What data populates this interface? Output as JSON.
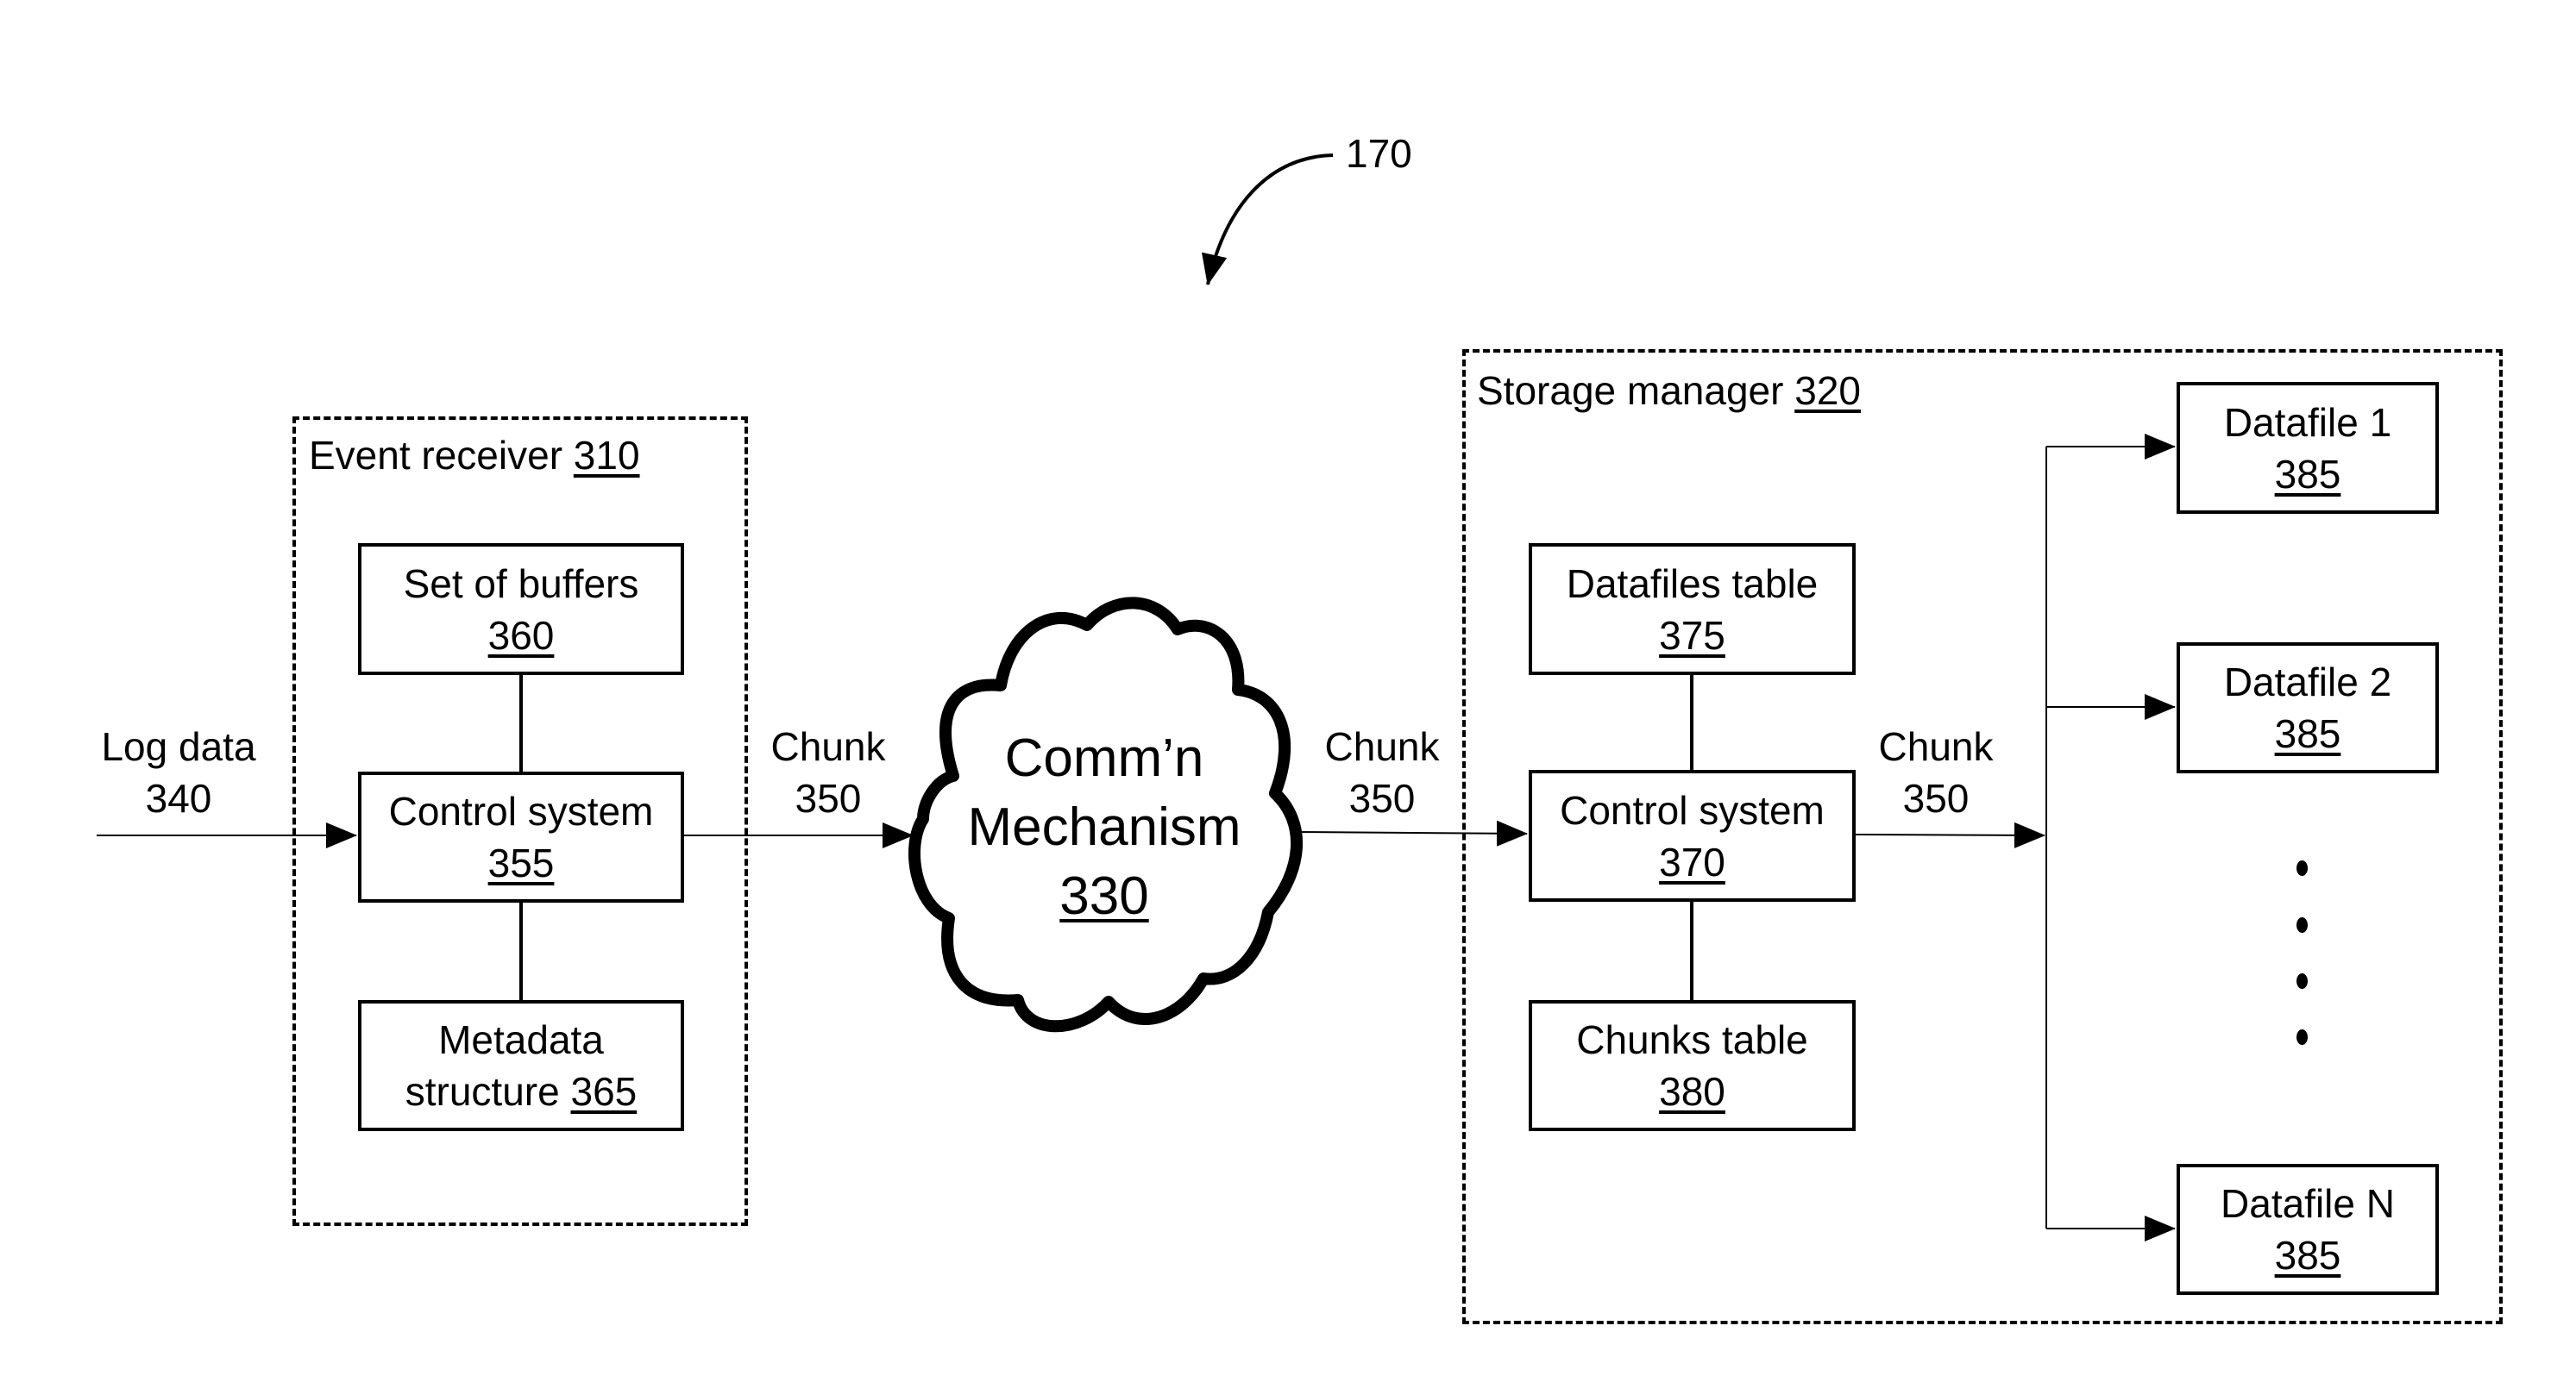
{
  "figure_ref": "170",
  "event_receiver": {
    "title": "Event receiver",
    "ref": "310",
    "buffers": {
      "label": "Set of buffers",
      "ref": "360"
    },
    "control": {
      "label": "Control system",
      "ref": "355"
    },
    "metadata": {
      "label1": "Metadata",
      "label2": "structure",
      "ref": "365"
    }
  },
  "input": {
    "label": "Log data",
    "ref": "340"
  },
  "chunk_labels": [
    {
      "label": "Chunk",
      "ref": "350"
    },
    {
      "label": "Chunk",
      "ref": "350"
    },
    {
      "label": "Chunk",
      "ref": "350"
    }
  ],
  "comm": {
    "line1": "Comm’n",
    "line2": "Mechanism",
    "ref": "330"
  },
  "storage_manager": {
    "title": "Storage manager",
    "ref": "320",
    "datafiles_table": {
      "label": "Datafiles table",
      "ref": "375"
    },
    "control": {
      "label": "Control system",
      "ref": "370"
    },
    "chunks_table": {
      "label": "Chunks table",
      "ref": "380"
    },
    "datafiles": [
      {
        "label": "Datafile 1",
        "ref": "385"
      },
      {
        "label": "Datafile 2",
        "ref": "385"
      },
      {
        "label": "Datafile N",
        "ref": "385"
      }
    ],
    "ellipsis_dots": 4
  }
}
